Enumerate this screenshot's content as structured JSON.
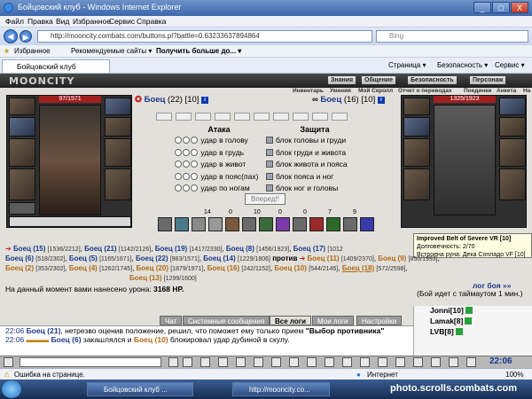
{
  "window": {
    "title": "Бойцовский клуб - Windows Internet Explorer",
    "min": "_",
    "max": "□",
    "close": "X"
  },
  "menu": [
    "Файл",
    "Правка",
    "Вид",
    "Избранное",
    "Сервис",
    "Справка"
  ],
  "address": {
    "url": "http://mooncity.combats.com/buttons.pl?battle=0.63233637894864",
    "search_placeholder": "Bing"
  },
  "favorites": {
    "label": "Избранное",
    "items": [
      "Рекомендуемые сайты ▾",
      "Получить больше до... ▾"
    ]
  },
  "tab": {
    "label": "Бойцовский клуб"
  },
  "toolbar": [
    "Страница ▾",
    "Безопасность ▾",
    "Сервис ▾"
  ],
  "game": {
    "logo": "MOONCITY",
    "topnav": [
      "Знания",
      "Общение",
      "Безопасность",
      "Персонаж"
    ],
    "subnav": [
      "Инвентарь",
      "Умения",
      "Мой Скролл",
      "Отчет о переводах",
      "Поединки",
      "Анкета",
      "На"
    ],
    "left_hp": "97/1571",
    "right_hp": "1325/1923",
    "left_fighter": {
      "name": "Боец",
      "level": "(22) [10]"
    },
    "right_fighter": {
      "name": "Боец",
      "level": "(16) [10]"
    },
    "attack": {
      "title": "Атака",
      "items": [
        "удар в голову",
        "удар в грудь",
        "удар в живот",
        "удар в пояс(пах)",
        "удар по ногам"
      ]
    },
    "defence": {
      "title": "Защита",
      "items": [
        "блок головы и груди",
        "блок груди и живота",
        "блок живота и пояса",
        "блок пояса и ног",
        "блок ног и головы"
      ]
    },
    "go_button": "Вперед!!",
    "stats": [
      "14",
      "0",
      "10",
      "0",
      "0",
      "7",
      "9"
    ],
    "tooltip": {
      "title": "Improved Belt of Severe VR [10]",
      "line1": "Долговечность: 2/70",
      "line2": "Встроена руна: Дека Сопладо VF [10]"
    },
    "team1": [
      {
        "name": "Боец",
        "lvl": "(15)",
        "hp": "[1536/2212]"
      },
      {
        "name": "Боец",
        "lvl": "(21)",
        "hp": "[1142/2126]"
      },
      {
        "name": "Боец",
        "lvl": "(19)",
        "hp": "[1417/2330]"
      },
      {
        "name": "Боец",
        "lvl": "(8)",
        "hp": "[1456/1923]"
      },
      {
        "name": "Боец",
        "lvl": "(17)",
        "hp": "[1012"
      },
      {
        "name": "Боец",
        "lvl": "(6)",
        "hp": "[518/2302]"
      },
      {
        "name": "Боец",
        "lvl": "(5)",
        "hp": "[1165/1671]"
      },
      {
        "name": "Боец",
        "lvl": "(22)",
        "hp": "[983/1571]"
      },
      {
        "name": "Боец",
        "lvl": "(14)",
        "hp": "[1229/1806]"
      }
    ],
    "versus": "против",
    "team2": [
      {
        "name": "Боец",
        "lvl": "(11)",
        "hp": "[1409/2370]"
      },
      {
        "name": "Боец",
        "lvl": "(9)",
        "hp": "[850/1993]"
      },
      {
        "name": "Боец",
        "lvl": "(2)",
        "hp": "[353/2302]"
      },
      {
        "name": "Боец",
        "lvl": "(4)",
        "hp": "[1262/1745]"
      },
      {
        "name": "Боец",
        "lvl": "(20)",
        "hp": "[1879/1971]"
      },
      {
        "name": "Боец",
        "lvl": "(16)",
        "hp": "[242/1152]"
      },
      {
        "name": "Боец",
        "lvl": "(10)",
        "hp": "[544/2146]"
      },
      {
        "name": "Боец",
        "lvl": "(18)",
        "hp": "[572/2598]"
      },
      {
        "name": "Боец",
        "lvl": "(13)",
        "hp": "[1299/1600]"
      }
    ],
    "damage_label": "На данный момент вами нанесено урона:",
    "damage_value": "3168 HP.",
    "battle_log": "лог боя »»",
    "timeout": "(Бой идет с таймаутом 1 мин.)"
  },
  "chat": {
    "tabs": [
      "Чат",
      "Системные сообщения",
      "Все логи",
      "Мои логи",
      "Настройки"
    ],
    "lines": [
      {
        "time": "22:06",
        "nick": "Боец",
        "lvl": "(21)",
        "text": ", нетрезво оценив положение, решил, что поможет ему только прием ",
        "bold": "\"Выбор противника\""
      },
      {
        "time": "22:06",
        "nick": "Боец",
        "lvl": "(6)",
        "text": " закашлялся и ",
        "nick2": "Боец",
        "lvl2": "(10)",
        "text2": " блокировал удар дубиной в скулу."
      }
    ],
    "users": [
      {
        "name": "Jonni[10]"
      },
      {
        "name": "Lamak[8]"
      },
      {
        "name": "LVB[8]"
      }
    ],
    "clock": "22:06"
  },
  "status": {
    "left": "Ошибка на странице.",
    "zone": "Интернет",
    "zoom": "100%"
  },
  "taskbar": {
    "tasks": [
      "Бойцовский клуб ...",
      "http://mooncity.co..."
    ],
    "watermark": "photo.scrolls.combats.com"
  }
}
